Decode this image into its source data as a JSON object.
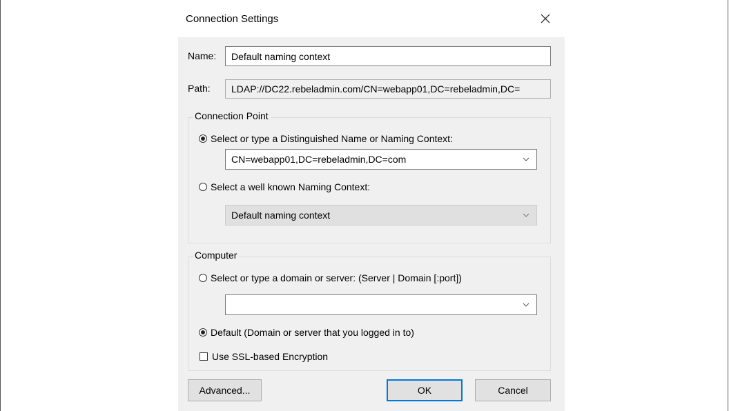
{
  "dialog": {
    "title": "Connection Settings",
    "close_icon": "close-icon"
  },
  "name_field": {
    "label": "Name:",
    "value": "Default naming context"
  },
  "path_field": {
    "label": "Path:",
    "value": "LDAP://DC22.rebeladmin.com/CN=webapp01,DC=rebeladmin,DC="
  },
  "connection_point": {
    "title": "Connection Point",
    "option_dn": {
      "label": "Select or type a Distinguished Name or Naming Context:",
      "checked": true
    },
    "dn_combo_value": "CN=webapp01,DC=rebeladmin,DC=com",
    "option_well_known": {
      "label": "Select a well known Naming Context:",
      "checked": false
    },
    "well_known_combo_value": "Default naming context"
  },
  "computer": {
    "title": "Computer",
    "option_server": {
      "label": "Select or type a domain or server: (Server | Domain [:port])",
      "checked": false
    },
    "server_combo_value": "",
    "option_default": {
      "label": "Default (Domain or server that you logged in to)",
      "checked": true
    },
    "ssl": {
      "label": "Use SSL-based Encryption",
      "checked": false
    }
  },
  "buttons": {
    "advanced": "Advanced...",
    "ok": "OK",
    "cancel": "Cancel"
  }
}
